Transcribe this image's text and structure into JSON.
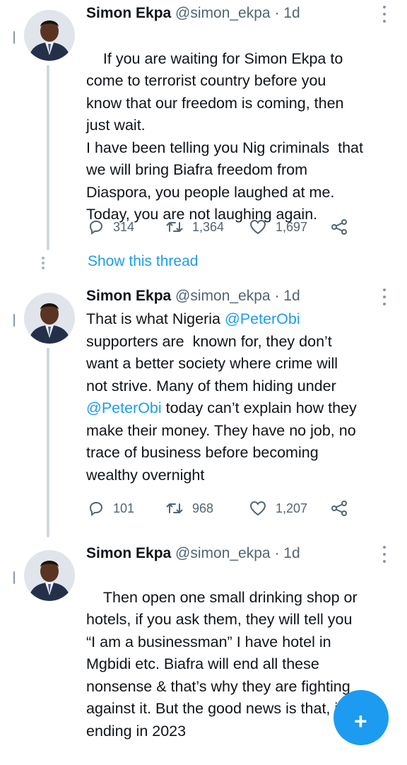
{
  "tweets": [
    {
      "name": "Simon Ekpa",
      "handle": "@simon_ekpa",
      "dot": "·",
      "time": "1d",
      "text_parts": [
        {
          "text": "If you are waiting for Simon Ekpa to\ncome to terrorist country before you\nknow that our freedom is coming, then\njust wait.\nI have been telling you Nig criminals  that\nwe will bring Biafra freedom from\nDiaspora, you people laughed at me.\nToday, you are not laughing again.",
          "mention": false
        }
      ],
      "replies": "314",
      "retweets": "1,364",
      "likes": "1,697"
    },
    {
      "name": "Simon Ekpa",
      "handle": "@simon_ekpa",
      "dot": "·",
      "time": "1d",
      "text_parts": [
        {
          "text": "That is what Nigeria ",
          "mention": false
        },
        {
          "text": "@PeterObi",
          "mention": true
        },
        {
          "text": "\nsupporters are  known for, they don’t\nwant a better society where crime will\nnot strive. Many of them hiding under\n",
          "mention": false
        },
        {
          "text": "@PeterObi",
          "mention": true
        },
        {
          "text": " today can’t explain how they\nmake their money. They have no job, no\ntrace of business before becoming\nwealthy overnight",
          "mention": false
        }
      ],
      "replies": "101",
      "retweets": "968",
      "likes": "1,207"
    },
    {
      "name": "Simon Ekpa",
      "handle": "@simon_ekpa",
      "dot": "·",
      "time": "1d",
      "text_parts": [
        {
          "text": "Then open one small drinking shop or\nhotels, if you ask them, they will tell you\n“I am a businessman” I have hotel in\nMgbidi etc. Biafra will end all these\nnonsense & that’s why they are fighting\nagainst it. But the good news is that, it is\nending in 2023",
          "mention": false
        }
      ]
    }
  ],
  "show_thread": "Show this thread",
  "colors": {
    "accent": "#1d9bf0",
    "muted": "#536471",
    "text": "#0f1419"
  },
  "icons": [
    "reply-icon",
    "retweet-icon",
    "like-icon",
    "share-icon",
    "more-options-icon",
    "compose-fab"
  ]
}
